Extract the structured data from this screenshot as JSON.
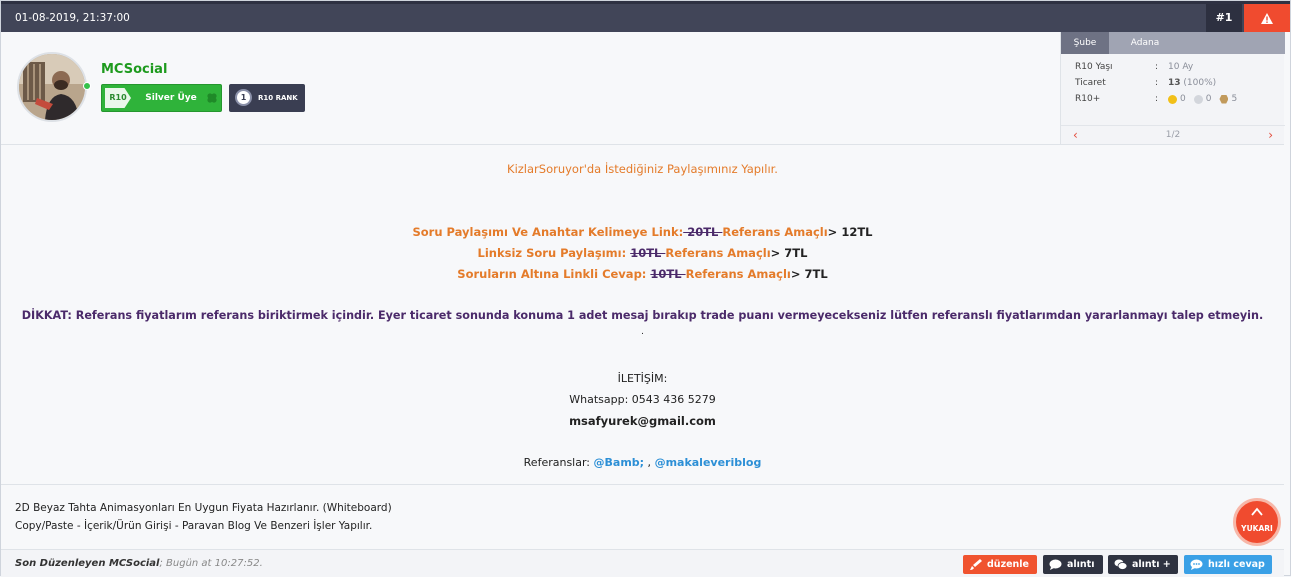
{
  "post": {
    "date": "01-08-2019, 21:37:00",
    "number": "#1"
  },
  "user": {
    "name": "MCSocial",
    "badge_r10": "R10",
    "badge_label": "Silver Üye",
    "rank_number": "1",
    "rank_label": "R10 RANK"
  },
  "sidepanel": {
    "tabs": [
      "Şube",
      "Adana"
    ],
    "rows": [
      {
        "key": "R10 Yaşı",
        "sep": ":",
        "value": "10 Ay"
      },
      {
        "key": "Ticaret",
        "sep": ":",
        "value": "13",
        "extra": "(100%)"
      },
      {
        "key": "R10+",
        "sep": ":",
        "gold": "0",
        "silver": "0",
        "bronze": "5"
      }
    ],
    "page": "1/2",
    "prev": "‹",
    "next": "›"
  },
  "message": {
    "intro": "KizlarSoruyor'da İstediğiniz Paylaşımınız Yapılır.",
    "offers": [
      {
        "title": "Soru Paylaşımı Ve Anahtar Kelimeye Link:",
        "old": " 20TL ",
        "ref": "Referans Amaçlı",
        "arrow": ">",
        "price": " 12TL"
      },
      {
        "title": "Linksiz Soru Paylaşımı: ",
        "old": "10TL ",
        "ref": "Referans Amaçlı",
        "arrow": ">",
        "price": " 7TL"
      },
      {
        "title": "Soruların Altına Linkli Cevap: ",
        "old": "10TL ",
        "ref": "Referans Amaçlı",
        "arrow": ">",
        "price": " 7TL"
      }
    ],
    "warning": "DİKKAT: Referans fiyatlarım referans biriktirmek içindir. Eyer ticaret sonunda konuma 1 adet mesaj bırakıp trade puanı vermeyecekseniz lütfen referanslı fiyatlarımdan yararlanmayı talep etmeyin.",
    "dot": ".",
    "contact_title": "İLETİŞİM:",
    "whatsapp": "Whatsapp: 0543 436 5279",
    "email": "msafyurek@gmail.com",
    "references_label": "Referanslar: ",
    "references": [
      "@Bamb;",
      "@makaleveriblog"
    ],
    "ref_separator": " , "
  },
  "signature": {
    "line1": "2D Beyaz Tahta Animasyonları En Uygun Fiyata Hazırlanır. (Whiteboard)",
    "line2": "Copy/Paste - İçerik/Ürün Girişi - Paravan Blog Ve Benzeri İşler Yapılır."
  },
  "scroll_top": {
    "label": "YUKARI"
  },
  "footer": {
    "edited_prefix": "Son Düzenleyen ",
    "edited_by": "MCSocial",
    "edited_time": "; Bugün at 10:27:52.",
    "buttons": {
      "edit": "düzenle",
      "quote": "alıntı",
      "quote_plus": "alıntı +",
      "quick_reply": "hızlı cevap"
    }
  },
  "colors": {
    "accent": "#f04b2f",
    "header": "#414558",
    "username": "#1d9a1d",
    "offer": "#e47b2a",
    "link": "#2c8fd6"
  }
}
